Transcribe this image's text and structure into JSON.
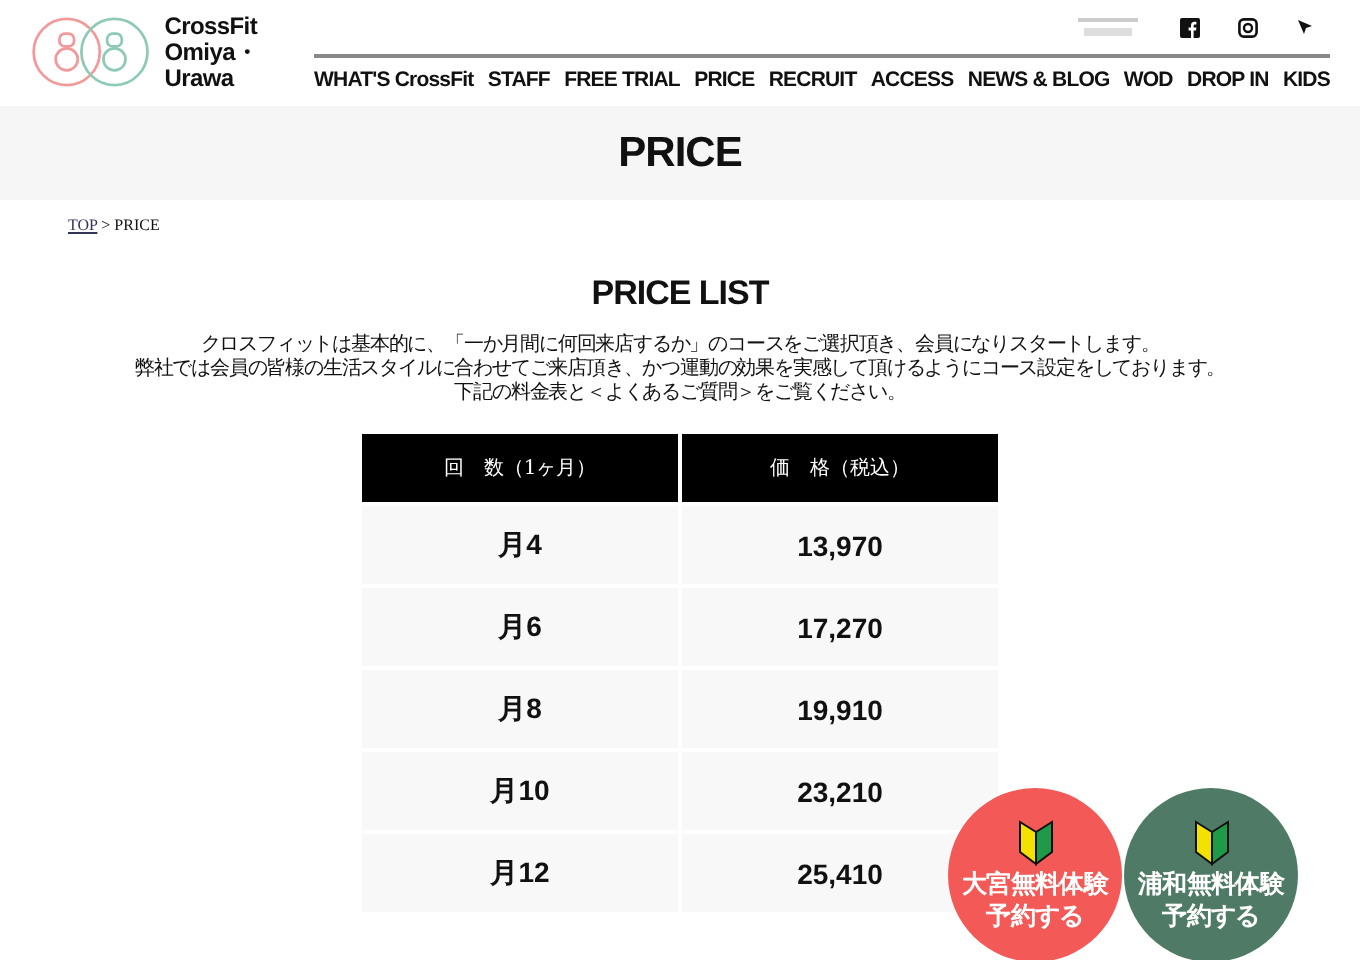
{
  "logo": {
    "line1": "CrossFit",
    "line2": "Omiya・Urawa"
  },
  "nav": [
    "WHAT'S CrossFit",
    "STAFF",
    "FREE TRIAL",
    "PRICE",
    "RECRUIT",
    "ACCESS",
    "NEWS & BLOG",
    "WOD",
    "DROP IN",
    "KIDS"
  ],
  "page_title": "PRICE",
  "breadcrumb": {
    "link": "TOP",
    "current": " > PRICE"
  },
  "section_title": "PRICE LIST",
  "intro": [
    "クロスフィットは基本的に、「一か月間に何回来店するか」のコースをご選択頂き、会員になりスタートします。",
    "弊社では会員の皆様の生活スタイルに合わせてご来店頂き、かつ運動の効果を実感して頂けるようにコース設定をしております。",
    "下記の料金表と＜よくあるご質問＞をご覧ください。"
  ],
  "table": {
    "columns": [
      "回　数（1ヶ月）",
      "価　格（税込）"
    ],
    "rows": [
      [
        "月4",
        "13,970"
      ],
      [
        "月6",
        "17,270"
      ],
      [
        "月8",
        "19,910"
      ],
      [
        "月10",
        "23,210"
      ],
      [
        "月12",
        "25,410"
      ]
    ]
  },
  "cta_buttons": [
    {
      "line1": "大宮無料体験",
      "line2": "予約する",
      "color": "#f35a57"
    },
    {
      "line1": "浦和無料体験",
      "line2": "予約する",
      "color": "#4f7b66"
    }
  ]
}
